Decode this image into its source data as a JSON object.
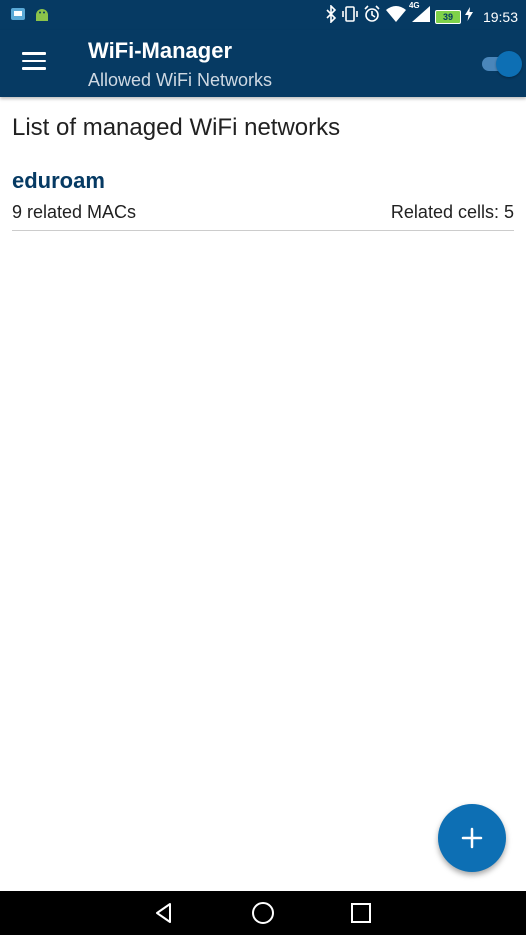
{
  "status_bar": {
    "time": "19:53",
    "battery": "39",
    "network": "4G",
    "icons": [
      "photos-icon",
      "android-icon",
      "bluetooth-icon",
      "vibrate-icon",
      "alarm-icon",
      "wifi-icon",
      "signal-icon",
      "battery-icon",
      "charging-icon"
    ]
  },
  "app_bar": {
    "title": "WiFi-Manager",
    "subtitle": "Allowed WiFi Networks",
    "toggle_on": true
  },
  "main": {
    "heading": "List of managed WiFi networks",
    "networks": [
      {
        "name": "eduroam",
        "macs": "9 related MACs",
        "cells": "Related cells: 5"
      }
    ]
  },
  "fab": {
    "icon": "add-icon"
  },
  "nav": {
    "buttons": [
      "back-icon",
      "home-icon",
      "recents-icon"
    ]
  },
  "colors": {
    "primary": "#063a63",
    "accent": "#0d6fb4",
    "toggle_track": "#4a86ba"
  }
}
